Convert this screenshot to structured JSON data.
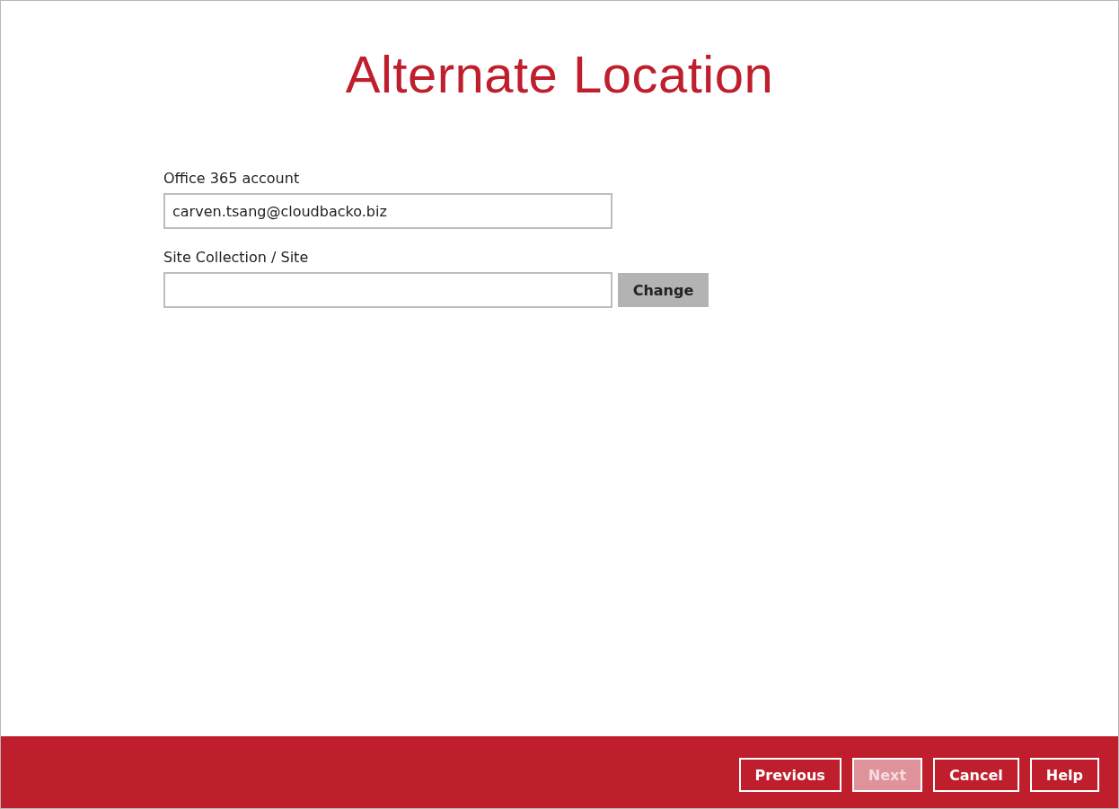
{
  "title": "Alternate Location",
  "fields": [
    {
      "label": "Office 365 account",
      "value": "carven.tsang@cloudbacko.biz"
    },
    {
      "label": "Site Collection / Site",
      "button": "Change"
    }
  ],
  "footer_buttons": [
    {
      "label": "Previous",
      "disabled": false
    },
    {
      "label": "Next",
      "disabled": true
    },
    {
      "label": "Cancel",
      "disabled": false
    },
    {
      "label": "Help",
      "disabled": false
    }
  ]
}
